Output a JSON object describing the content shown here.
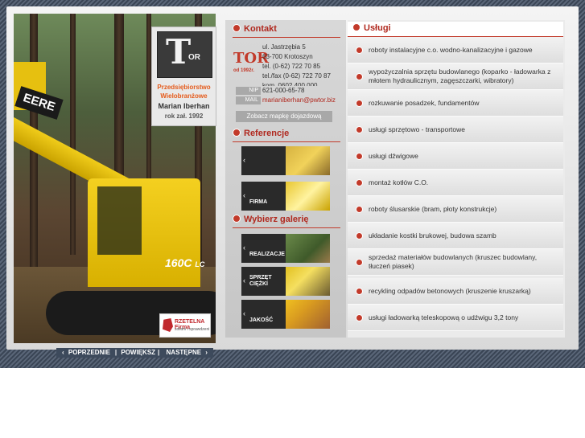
{
  "photo": {
    "brand_text": "EERE",
    "model_text": "160C",
    "model_suffix": "LC"
  },
  "logo": {
    "mark": "T",
    "mark_small": "OR",
    "line1": "Przedsiębiorstwo",
    "line2": "Wielobranżowe",
    "name": "Marian Iberhan",
    "founded": "rok zał. 1992"
  },
  "rzetelna": {
    "title": "RZETELNA Firma",
    "sub": "solidni i sprawdzeni"
  },
  "contact": {
    "heading": "Kontakt",
    "tor_mark": "TOR",
    "tor_since": "od 1992r.",
    "address1": "ul. Jastrzębia 5",
    "address2": "63-700 Krotoszyn",
    "tel": "tel. (0-62) 722 70 85",
    "telfax": "tel./fax (0-62) 722 70 87",
    "kom": "kom. 0602 400 000",
    "nip_label": "NIP",
    "nip_value": "621-000-65-78",
    "mail_label": "MAIL",
    "mail_value": "marianiberhan@pwtor.biz",
    "map_button": "Zobacz mapkę dojazdową"
  },
  "references": {
    "heading": "Referencje",
    "items": [
      {
        "label": ""
      },
      {
        "label": "FIRMA"
      }
    ]
  },
  "gallery": {
    "heading": "Wybierz galerię",
    "items": [
      {
        "label": "REALIZACJE"
      },
      {
        "label": "SPRZĘT CIĘŻKI"
      },
      {
        "label": "JAKOŚĆ"
      }
    ]
  },
  "services": {
    "heading": "Usługi",
    "items": [
      "roboty instalacyjne c.o. wodno-kanalizacyjne i gazowe",
      "wypożyczalnia sprzętu budowlanego (koparko - ładowarka z młotem hydraulicznym, zagęszczarki, wibratory)",
      "rozkuwanie posadzek, fundamentów",
      "usługi sprzętowo - transportowe",
      "usługi dźwigowe",
      "montaż kotłów C.O.",
      "roboty ślusarskie (bram, płoty konstrukcje)",
      "układanie kostki brukowej, budowa szamb",
      "sprzedaż materiałów budowlanych (kruszec budowlany, tłuczeń piasek)",
      "recykling odpadów betonowych (kruszenie kruszarką)",
      "usługi ładowarką teleskopową o udźwigu 3,2 tony"
    ]
  },
  "nav": {
    "prev": "POPRZEDNIE",
    "zoom": "POWIĘKSZ",
    "next": "NASTĘPNE"
  }
}
